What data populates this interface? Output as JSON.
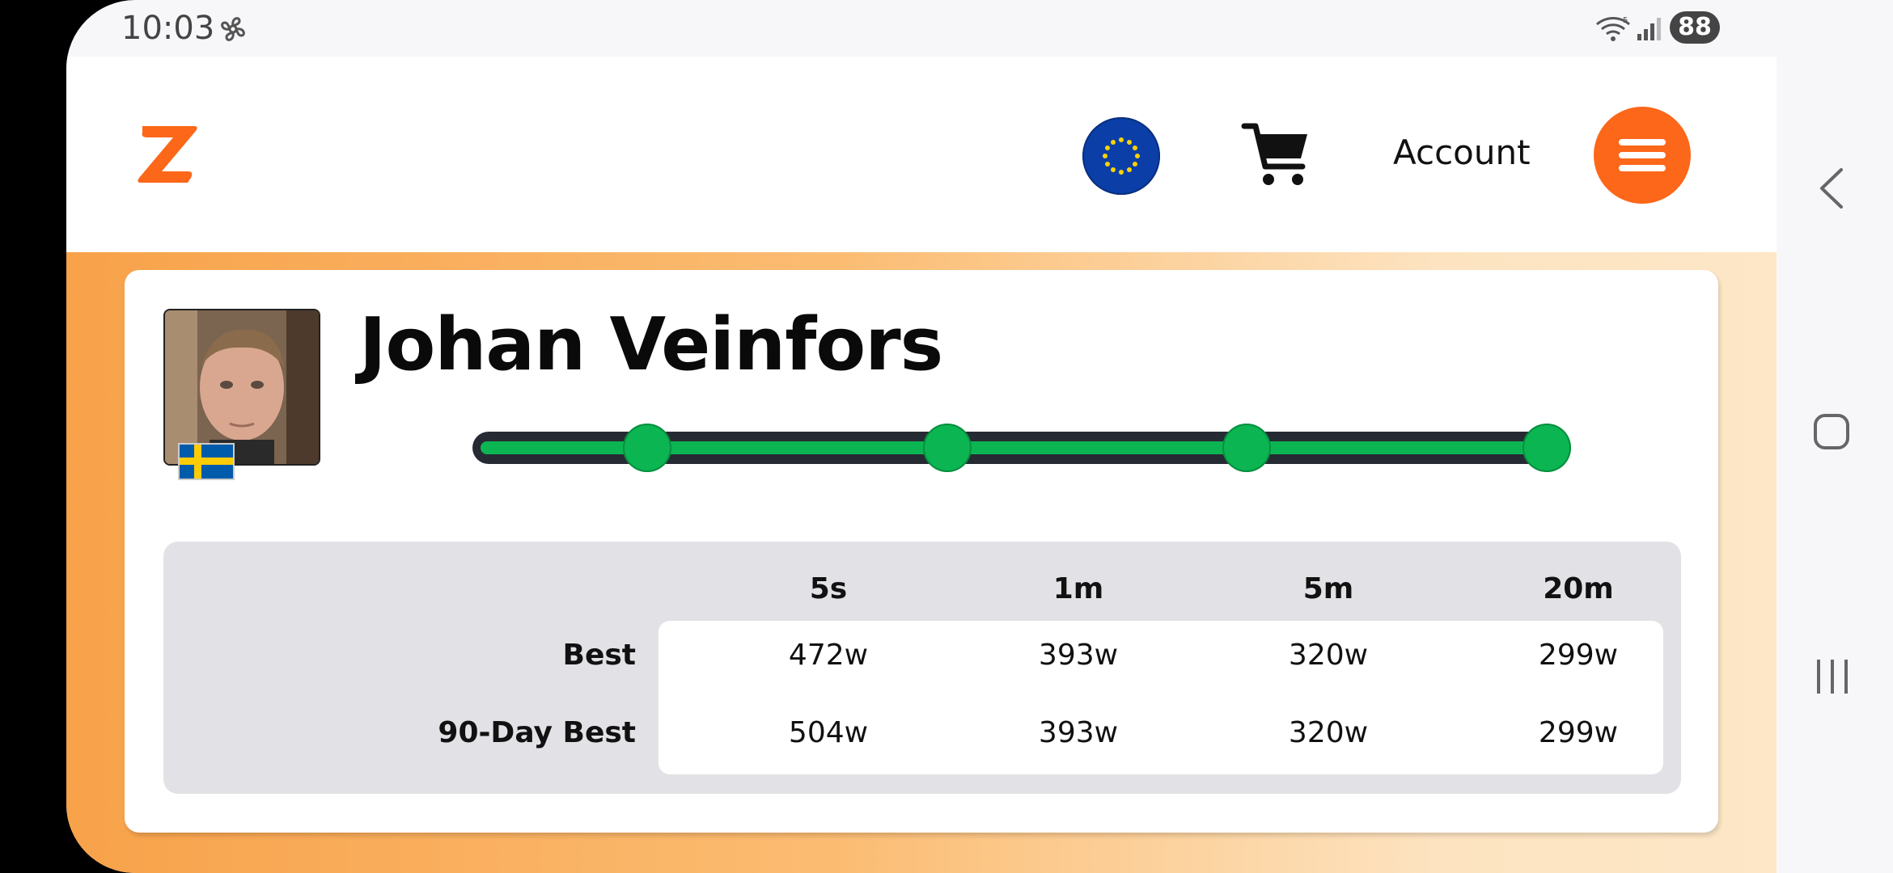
{
  "status_bar": {
    "time": "10:03",
    "battery": "88",
    "icons": [
      "fan-icon",
      "wifi-icon",
      "signal-icon"
    ]
  },
  "header": {
    "logo_icon": "zwift-logo",
    "region_icon": "eu-flag-icon",
    "cart_icon": "cart-icon",
    "account_label": "Account",
    "menu_icon": "hamburger-menu-icon",
    "accent_color": "#fc6719"
  },
  "profile": {
    "name": "Johan Veinfors",
    "country_flag": "sweden-flag-icon",
    "progress": {
      "steps_total": 4,
      "steps_completed": 4,
      "color": "#0bb652"
    }
  },
  "power_table": {
    "columns": [
      "5s",
      "1m",
      "5m",
      "20m"
    ],
    "rows": [
      {
        "label": "Best",
        "values": [
          "472w",
          "393w",
          "320w",
          "299w"
        ]
      },
      {
        "label": "90-Day Best",
        "values": [
          "504w",
          "393w",
          "320w",
          "299w"
        ]
      }
    ]
  },
  "nav_bar": {
    "icons": [
      "back-icon",
      "home-icon",
      "recents-icon"
    ]
  }
}
